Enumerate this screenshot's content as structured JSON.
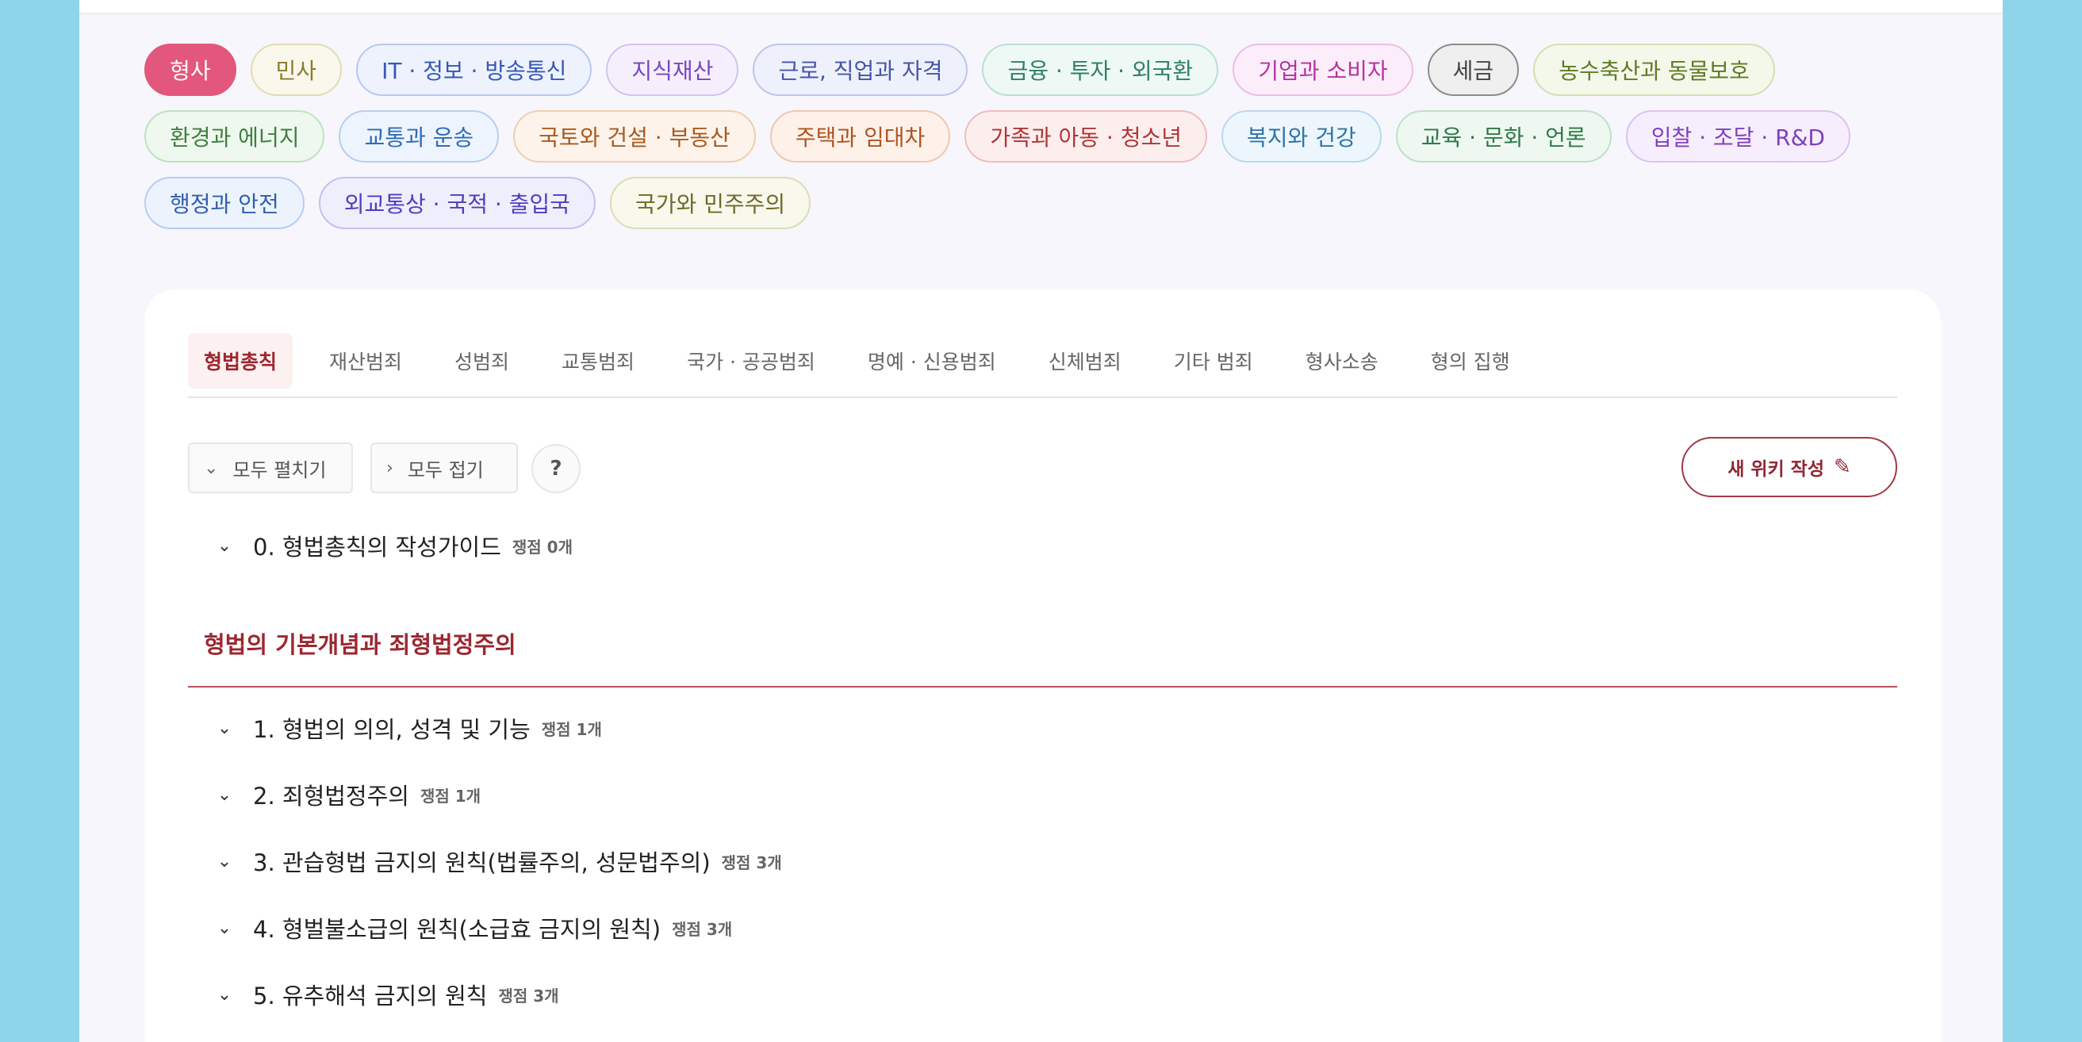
{
  "categories": [
    {
      "label": "형사",
      "active": true
    },
    {
      "label": "민사",
      "bg": "#faf8ec",
      "border": "#e3dcb4",
      "color": "#8a7a2c"
    },
    {
      "label": "IT · 정보 · 방송통신",
      "bg": "#eef2fd",
      "border": "#b9c8f2",
      "color": "#3558b8"
    },
    {
      "label": "지식재산",
      "bg": "#f5effd",
      "border": "#d4c2f0",
      "color": "#7a45c4"
    },
    {
      "label": "근로, 직업과 자격",
      "bg": "#eef1fb",
      "border": "#bdc6ea",
      "color": "#4455a8"
    },
    {
      "label": "금융 · 투자 · 외국환",
      "bg": "#eef8f5",
      "border": "#b9e0d4",
      "color": "#2f7f67"
    },
    {
      "label": "기업과 소비자",
      "bg": "#fcedfa",
      "border": "#eebde6",
      "color": "#b334a0"
    },
    {
      "label": "세금",
      "bg": "#efefef",
      "border": "#8c8c8c",
      "color": "#444444"
    },
    {
      "label": "농수축산과 동물보호",
      "bg": "#f4f8ea",
      "border": "#d2e0b2",
      "color": "#5f7a25"
    },
    {
      "label": "환경과 에너지",
      "bg": "#eef8ee",
      "border": "#bfe2bf",
      "color": "#3e7f3e"
    },
    {
      "label": "교통과 운송",
      "bg": "#edf4fd",
      "border": "#b6cff0",
      "color": "#2e6bb8"
    },
    {
      "label": "국토와 건설 · 부동산",
      "bg": "#fdf3ea",
      "border": "#efcfae",
      "color": "#a85a1e"
    },
    {
      "label": "주택과 임대차",
      "bg": "#fdf1ea",
      "border": "#f0c8ae",
      "color": "#b05420"
    },
    {
      "label": "가족과 아동 · 청소년",
      "bg": "#fdeeee",
      "border": "#f0bdbd",
      "color": "#b23434"
    },
    {
      "label": "복지와 건강",
      "bg": "#edf6fd",
      "border": "#b9d9f0",
      "color": "#2d74a8"
    },
    {
      "label": "교육 · 문화 · 언론",
      "bg": "#eef8f1",
      "border": "#bfe0c9",
      "color": "#2f7a48"
    },
    {
      "label": "입찰 · 조달 · R&D",
      "bg": "#f6eefd",
      "border": "#dcc2f2",
      "color": "#8040c0"
    },
    {
      "label": "행정과 안전",
      "bg": "#edf3fd",
      "border": "#b8cdf0",
      "color": "#3060b0"
    },
    {
      "label": "외교통상 · 국적 · 출입국",
      "bg": "#efeefd",
      "border": "#c4c0f0",
      "color": "#4c3fbf"
    },
    {
      "label": "국가와 민주주의",
      "bg": "#f8f8ec",
      "border": "#dcdcb6",
      "color": "#6e6a2a"
    }
  ],
  "tabs": [
    {
      "label": "형법총칙",
      "active": true
    },
    {
      "label": "재산범죄"
    },
    {
      "label": "성범죄"
    },
    {
      "label": "교통범죄"
    },
    {
      "label": "국가 · 공공범죄"
    },
    {
      "label": "명예 · 신용범죄"
    },
    {
      "label": "신체범죄"
    },
    {
      "label": "기타 범죄"
    },
    {
      "label": "형사소송"
    },
    {
      "label": "형의 집행"
    }
  ],
  "toolbar": {
    "expand_all": "모두 펼치기",
    "collapse_all": "모두 접기",
    "help": "?",
    "new_wiki": "새 위키 작성"
  },
  "guide_item": {
    "title": "0. 형법총칙의 작성가이드",
    "count": "쟁점 0개"
  },
  "section": {
    "title": "형법의 기본개념과 죄형법정주의",
    "items": [
      {
        "title": "1. 형법의 의의, 성격 및 기능",
        "count": "쟁점 1개"
      },
      {
        "title": "2. 죄형법정주의",
        "count": "쟁점 1개"
      },
      {
        "title": "3. 관습형법 금지의 원칙(법률주의, 성문법주의)",
        "count": "쟁점 3개"
      },
      {
        "title": "4. 형벌불소급의 원칙(소급효 금지의 원칙)",
        "count": "쟁점 3개"
      },
      {
        "title": "5. 유추해석 금지의 원칙",
        "count": "쟁점 3개"
      }
    ]
  },
  "icons": {
    "chevron": "⌄",
    "chevron_right": "›",
    "pencil": "✎"
  }
}
